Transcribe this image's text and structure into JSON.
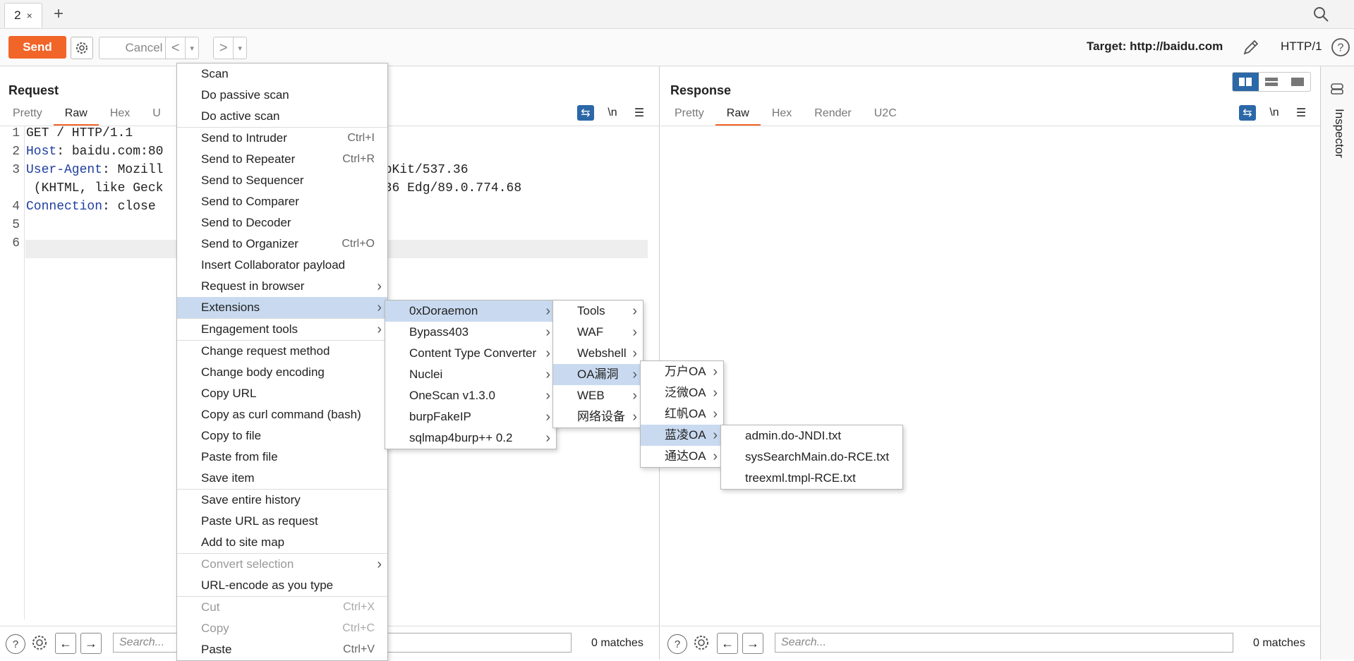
{
  "tabs": {
    "active_label": "2",
    "close_glyph": "×",
    "new_tab_glyph": "+"
  },
  "toolbar": {
    "send_label": "Send",
    "cancel_label": "Cancel",
    "back_glyph": "<",
    "forward_glyph": ">",
    "dropdown_glyph": "▾",
    "target_label": "Target: http://baidu.com",
    "http_version": "HTTP/1"
  },
  "request": {
    "title": "Request",
    "tabs": [
      "Pretty",
      "Raw",
      "Hex",
      "U"
    ],
    "active_tab": "Raw",
    "newline_toggle": "\\n",
    "lines": [
      {
        "num": "1",
        "name": "",
        "value": "GET / HTTP/1.1"
      },
      {
        "num": "2",
        "name": "Host",
        "value": ": baidu.com:80"
      },
      {
        "num": "3",
        "name": "User-Agent",
        "value": ": Mozill          Win64; x64) AppleWebKit/537.36"
      },
      {
        "num": "",
        "name": "",
        "value": " (KHTML, like Geck                  Safari/537.36 Edg/89.0.774.68"
      },
      {
        "num": "4",
        "name": "Connection",
        "value": ": close"
      },
      {
        "num": "5",
        "name": "",
        "value": ""
      },
      {
        "num": "6",
        "name": "",
        "value": ""
      }
    ],
    "search_placeholder": "Search...",
    "matches": "0 matches"
  },
  "response": {
    "title": "Response",
    "tabs": [
      "Pretty",
      "Raw",
      "Hex",
      "Render",
      "U2C"
    ],
    "active_tab": "Raw",
    "newline_toggle": "\\n",
    "search_placeholder": "Search...",
    "matches": "0 matches"
  },
  "inspector": {
    "label": "Inspector"
  },
  "context_menu": {
    "groups": [
      [
        {
          "label": "Scan"
        },
        {
          "label": "Do passive scan"
        },
        {
          "label": "Do active scan"
        }
      ],
      [
        {
          "label": "Send to Intruder",
          "shortcut": "Ctrl+I"
        },
        {
          "label": "Send to Repeater",
          "shortcut": "Ctrl+R"
        },
        {
          "label": "Send to Sequencer"
        },
        {
          "label": "Send to Comparer"
        },
        {
          "label": "Send to Decoder"
        },
        {
          "label": "Send to Organizer",
          "shortcut": "Ctrl+O"
        },
        {
          "label": "Insert Collaborator payload"
        },
        {
          "label": "Request in browser",
          "submenu": true
        },
        {
          "label": "Extensions",
          "submenu": true,
          "highlighted": true
        }
      ],
      [
        {
          "label": "Engagement tools",
          "submenu": true
        }
      ],
      [
        {
          "label": "Change request method"
        },
        {
          "label": "Change body encoding"
        },
        {
          "label": "Copy URL"
        },
        {
          "label": "Copy as curl command (bash)"
        },
        {
          "label": "Copy to file"
        },
        {
          "label": "Paste from file"
        },
        {
          "label": "Save item"
        }
      ],
      [
        {
          "label": "Save entire history"
        },
        {
          "label": "Paste URL as request"
        },
        {
          "label": "Add to site map"
        }
      ],
      [
        {
          "label": "Convert selection",
          "submenu": true,
          "disabled": true
        },
        {
          "label": "URL-encode as you type"
        }
      ],
      [
        {
          "label": "Cut",
          "shortcut": "Ctrl+X",
          "disabled": true
        },
        {
          "label": "Copy",
          "shortcut": "Ctrl+C",
          "disabled": true
        },
        {
          "label": "Paste",
          "shortcut": "Ctrl+V"
        }
      ]
    ]
  },
  "extensions_menu": [
    {
      "label": "0xDoraemon",
      "highlighted": true
    },
    {
      "label": "Bypass403"
    },
    {
      "label": "Content Type Converter"
    },
    {
      "label": "Nuclei"
    },
    {
      "label": "OneScan v1.3.0"
    },
    {
      "label": "burpFakeIP"
    },
    {
      "label": "sqlmap4burp++ 0.2"
    }
  ],
  "doraemon_menu": [
    {
      "label": "Tools"
    },
    {
      "label": "WAF"
    },
    {
      "label": "Webshell"
    },
    {
      "label": "OA漏洞",
      "highlighted": true
    },
    {
      "label": "WEB"
    },
    {
      "label": "网络设备"
    }
  ],
  "oa_menu": [
    {
      "label": "万户OA"
    },
    {
      "label": "泛微OA"
    },
    {
      "label": "红帆OA"
    },
    {
      "label": "蓝凌OA",
      "highlighted": true
    },
    {
      "label": "通达OA"
    }
  ],
  "landray_menu": [
    {
      "label": "admin.do-JNDI.txt"
    },
    {
      "label": "sysSearchMain.do-RCE.txt"
    },
    {
      "label": "treexml.tmpl-RCE.txt"
    }
  ],
  "colors": {
    "accent": "#f16529",
    "highlight": "#c9daf0",
    "header_blue": "#1f3fa0",
    "toggle_blue": "#2b68a8"
  },
  "icons": [
    "search-icon",
    "gear-icon",
    "pencil-icon",
    "help-icon",
    "wrap-icon",
    "menu-icon",
    "arrow-left-icon",
    "arrow-right-icon",
    "inspector-icon"
  ]
}
